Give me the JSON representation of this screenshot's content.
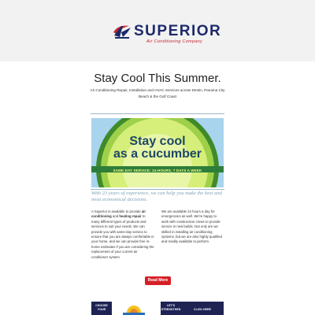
{
  "logo": {
    "name": "SUPERIOR",
    "tagline": "Air Conditioning Company",
    "colors": {
      "navy": "#1d2a6b",
      "red": "#c8252c"
    }
  },
  "headline": "Stay Cool This Summer.",
  "subheadline": "Air Conditioning Repair, Installation and HVAC Services across Destin, Panama City Beach & the Gulf Coast",
  "hero": {
    "title_line1": "Stay cool",
    "title_line2": "as a cucumber",
    "strip": "SAME-DAY SERVICE: 24-HOURS, 7 DAYS A WEEK"
  },
  "tagline": "With 23 years of experience, we can help you make the best and most economical decisions.",
  "body": {
    "left_a": "A Superior is available to provide ",
    "left_bold1": "air conditioning",
    "left_b": " and ",
    "left_bold2": "heating repair",
    "left_c": " to many different types of products and services to suit your needs. We can provide you with same-day service to ensure that you are always comfortable in your home, and we can provide free in-home estimates if you are considering the replacement of your current air conditioner system",
    "right": "We are available 24 hours a day for emergencies as well. We're happy to work with construction crews to provide service in new builds. Not only are we skilled in installing air conditioning systems, but we are also highly qualified and readily available to perform"
  },
  "button": {
    "label": "Read More"
  },
  "promos": {
    "left_line1": "CHOOSE",
    "left_line2": "YOUR",
    "right_line1": "LET'S",
    "right_line2": "STRENGTHEN",
    "far_line2": "CLICK HERE"
  },
  "colors": {
    "header_bg": "#f2f2f2",
    "accent_red": "#d42025",
    "navy": "#1e2354",
    "hero_bg": "#a8d4ee",
    "tagline": "#7aa1b5"
  }
}
